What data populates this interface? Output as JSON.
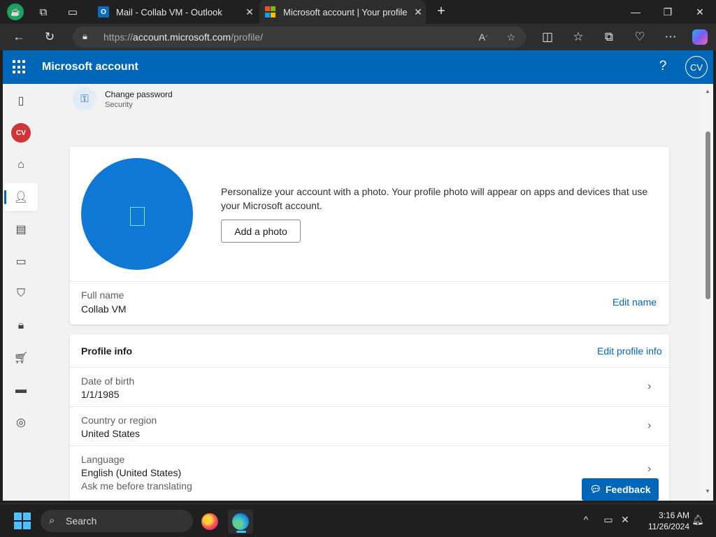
{
  "browser": {
    "tabs": [
      {
        "title": "Mail - Collab VM - Outlook",
        "active": false
      },
      {
        "title": "Microsoft account | Your profile",
        "active": true
      }
    ],
    "address": {
      "prefix": "https://",
      "domain": "account.microsoft.com",
      "path": "/profile/"
    },
    "icons": {
      "workspaces": "workspaces-icon",
      "collections": "collections-icon",
      "tab_actions": "tab-actions-icon",
      "read_aloud": "read-aloud-icon",
      "favorite": "star-icon",
      "split": "split-screen-icon",
      "favorites": "favorites-icon",
      "collections_btn": "collections-icon",
      "health": "browser-essentials-icon",
      "more": "more-icon",
      "copilot": "copilot-icon"
    }
  },
  "header": {
    "brand": "Microsoft account",
    "avatar_initials": "CV"
  },
  "left_nav": {
    "avatar_initials": "CV",
    "items": [
      "phone-icon",
      "avatar",
      "home-icon",
      "profile-icon",
      "orders-icon",
      "devices-icon",
      "shield-icon",
      "lock-icon",
      "cart-icon",
      "payment-icon",
      "location-icon"
    ],
    "selected": "profile-icon"
  },
  "change_password": {
    "title": "Change password",
    "subtitle": "Security"
  },
  "photo_card": {
    "description": "Personalize your account with a photo. Your profile photo will appear on apps and devices that use your Microsoft account.",
    "add_photo_label": "Add a photo",
    "full_name_label": "Full name",
    "full_name_value": "Collab VM",
    "edit_name_label": "Edit name"
  },
  "profile_info": {
    "heading": "Profile info",
    "edit_label": "Edit profile info",
    "rows": [
      {
        "label": "Date of birth",
        "value": "1/1/1985"
      },
      {
        "label": "Country or region",
        "value": "United States"
      },
      {
        "label": "Language",
        "value": "English (United States)",
        "sub": "Ask me before translating"
      }
    ]
  },
  "feedback_label": "Feedback",
  "taskbar": {
    "search_placeholder": "Search",
    "time": "3:16 AM",
    "date": "11/26/2024"
  },
  "colors": {
    "ms_blue": "#0067b8",
    "photo_blue": "#0f78d4",
    "avatar_red": "#d13438",
    "taskbar": "#1f1f1f"
  }
}
